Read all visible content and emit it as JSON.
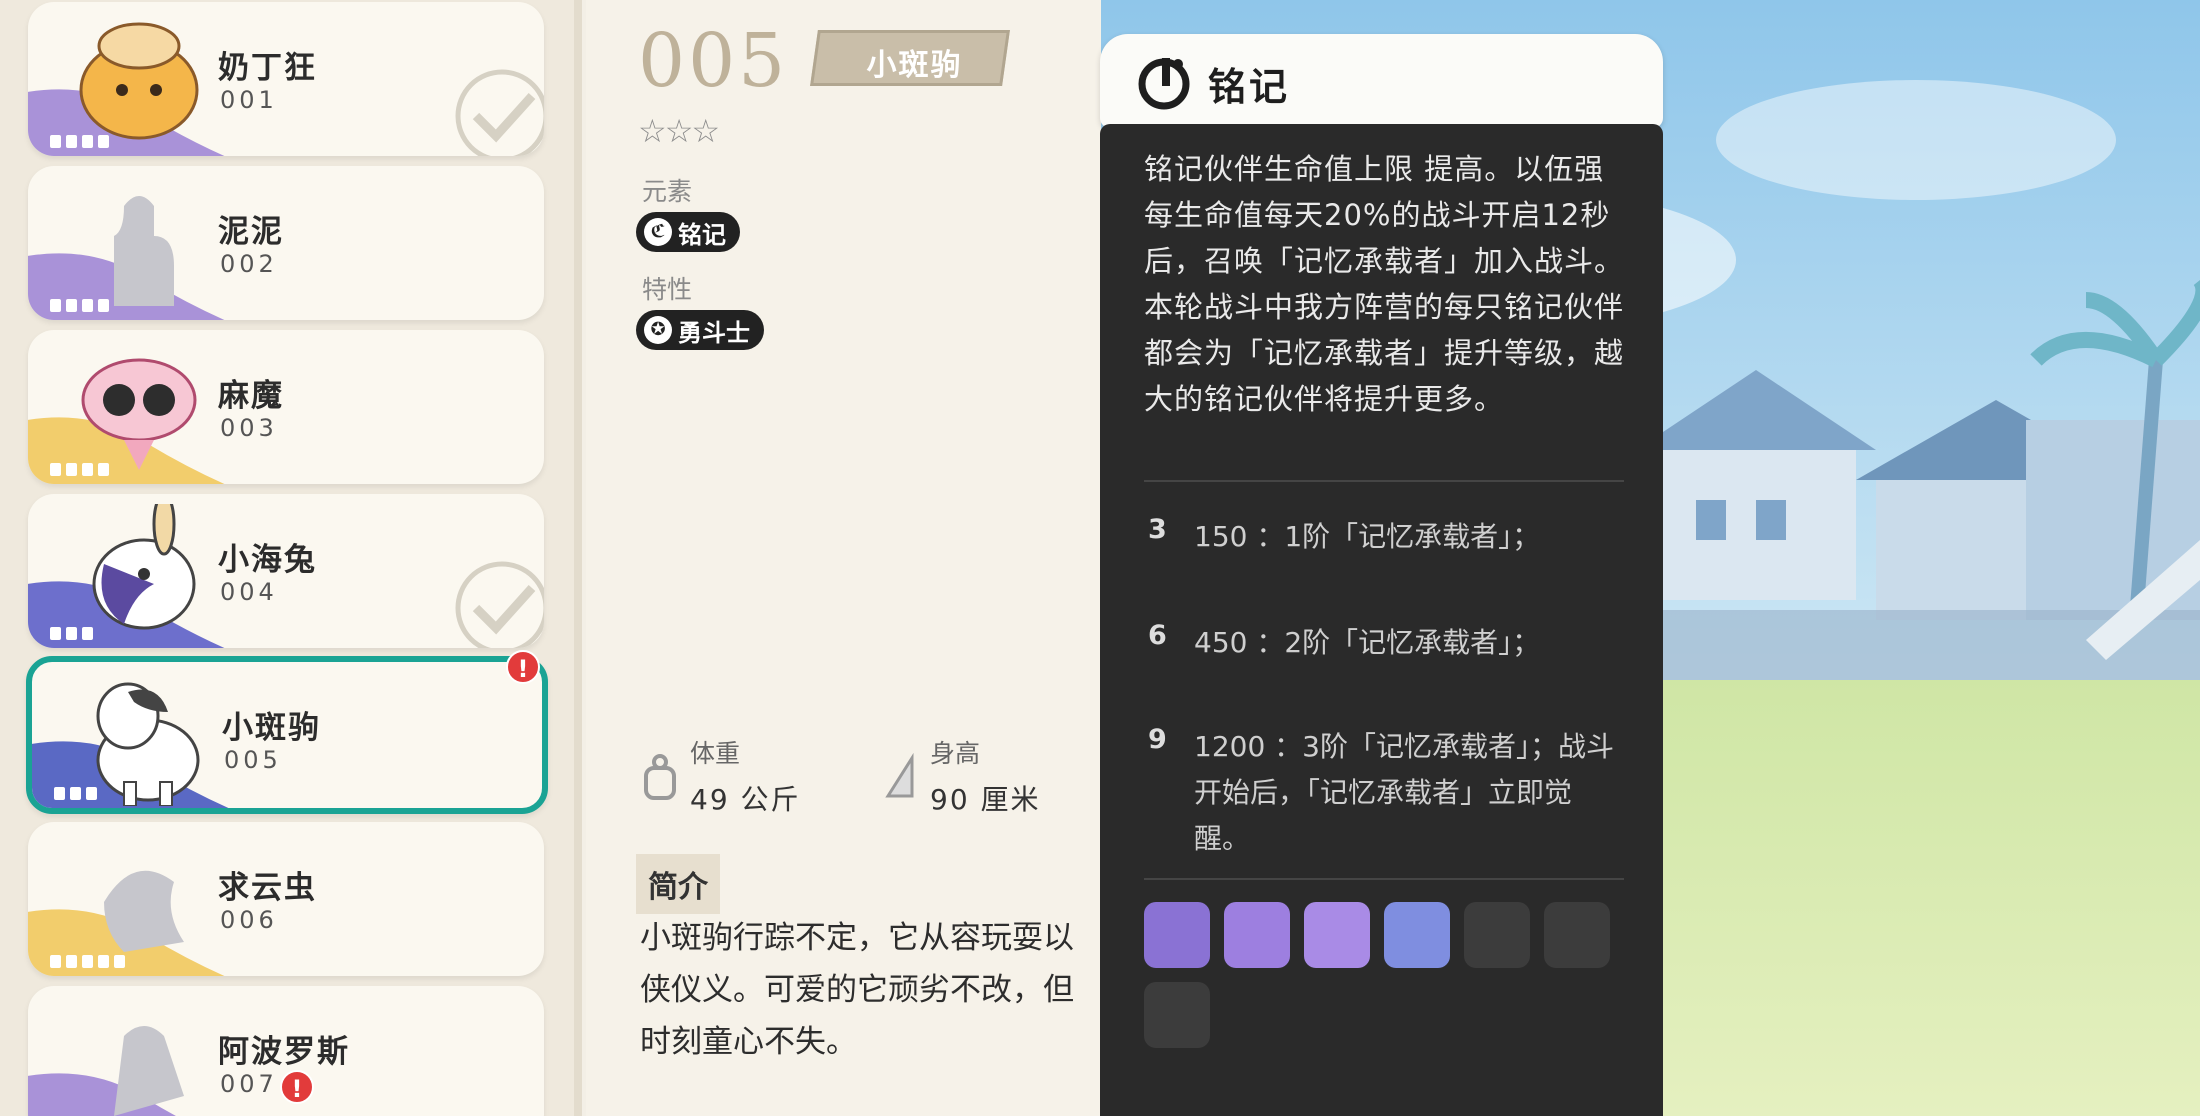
{
  "pets": [
    {
      "name": "奶丁狂",
      "number": "001",
      "alert": ""
    },
    {
      "name": "泥泥",
      "number": "002",
      "alert": ""
    },
    {
      "name": "麻魔",
      "number": "003",
      "alert": ""
    },
    {
      "name": "小海兔",
      "number": "004",
      "alert": ""
    },
    {
      "name": "小斑驹",
      "number": "005",
      "alert": "!"
    },
    {
      "name": "求云虫",
      "number": "006",
      "alert": ""
    },
    {
      "name": "阿波罗斯",
      "number": "007",
      "alert": "!"
    }
  ],
  "detail": {
    "number": "005",
    "name": "小斑驹",
    "stars": "☆☆☆",
    "element_label": "元素",
    "element_value": "铭记",
    "trait_label": "特性",
    "trait_value": "勇斗士",
    "weight_label": "体重",
    "weight_value": "49 公斤",
    "height_label": "身高",
    "height_value": "90 厘米",
    "intro_label": "简介",
    "intro_lines": [
      "小斑驹行踪不定，它从容玩耍以",
      "侠仪义。可爱的它顽劣不改，但",
      "时刻童心不失。"
    ]
  },
  "panel": {
    "title": "铭记",
    "description": "铭记伙伴生命值上限 提高。以伍强每生命值每天20%的战斗开启12秒后，召唤「记忆承载者」加入战斗。本轮战斗中我方阵营的每只铭记伙伴都会为「记忆承载者」提升等级，越大的铭记伙伴将提升更多。",
    "tiers": [
      {
        "level": "3",
        "text": "150 ：1阶「记忆承载者」；"
      },
      {
        "level": "6",
        "text": "450 ：2阶「记忆承载者」；"
      },
      {
        "level": "9",
        "text": "1200 ：3阶「记忆承载者」；战斗开始后，「记忆承载者」立即觉醒。"
      }
    ]
  },
  "colors": {
    "accent": "#1aa394",
    "alert": "#e23b3b",
    "panel_bg": "#2a2a2a"
  }
}
